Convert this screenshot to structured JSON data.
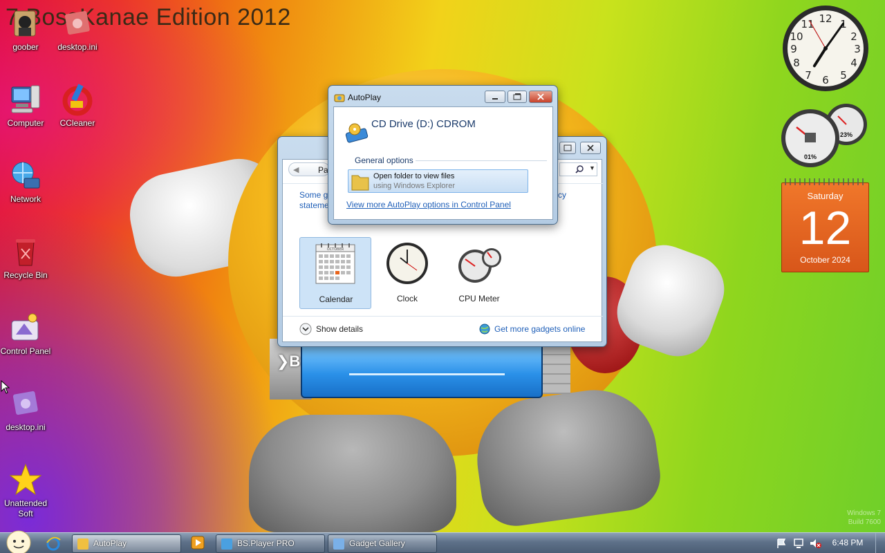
{
  "wallpaper": {
    "watermark": "7 BossKanae Edition 2012",
    "corner_text": [
      "Windows 7",
      "Build 7600"
    ]
  },
  "desktop_icons": [
    {
      "label": "goober",
      "icon": "user-folder-icon"
    },
    {
      "label": "desktop.ini",
      "icon": "settings-file-icon"
    },
    {
      "label": "Computer",
      "icon": "computer-icon"
    },
    {
      "label": "CCleaner",
      "icon": "ccleaner-icon"
    },
    {
      "label": "Network",
      "icon": "network-icon"
    },
    {
      "label": "Recycle Bin",
      "icon": "recycle-bin-icon"
    },
    {
      "label": "Control Panel",
      "icon": "control-panel-icon"
    },
    {
      "label": "desktop.ini",
      "icon": "settings-file-icon"
    },
    {
      "label": "Unattended Soft",
      "icon": "star-icon"
    }
  ],
  "gadget_gallery": {
    "title": "Gadget Gallery",
    "page_label": "Pa",
    "description_left": [
      "Some g",
      "stateme"
    ],
    "description_right": "cy",
    "gadgets": [
      {
        "name": "Calendar",
        "selected": true
      },
      {
        "name": "Clock",
        "selected": false
      },
      {
        "name": "CPU Meter",
        "selected": false
      }
    ],
    "show_details": "Show details",
    "get_more": "Get more gadgets online"
  },
  "autoplay": {
    "title": "AutoPlay",
    "drive": "CD Drive (D:) CDROM",
    "section": "General options",
    "option_title": "Open folder to view files",
    "option_sub": "using Windows Explorer",
    "more_link": "View more AutoPlay options in Control Panel"
  },
  "desktop_gadgets": {
    "clock": {
      "hour": 7,
      "minute": 5,
      "second": 55
    },
    "cpu_meter": {
      "cpu": "01%",
      "memory": "23%"
    },
    "calendar": {
      "day_name": "Saturday",
      "day": "12",
      "month_year": "October 2024"
    }
  },
  "calendar_icon_month": "OCTOBER",
  "taskbar": {
    "items": [
      {
        "label": "AutoPlay",
        "active": true
      },
      {
        "label": "BS.Player PRO",
        "active": false
      },
      {
        "label": "Gadget Gallery",
        "active": false
      }
    ],
    "clock": "6:48 PM"
  },
  "colors": {
    "link": "#1f5fb8",
    "calendar_orange": "#e8631a",
    "selection": "#cde3f7"
  }
}
